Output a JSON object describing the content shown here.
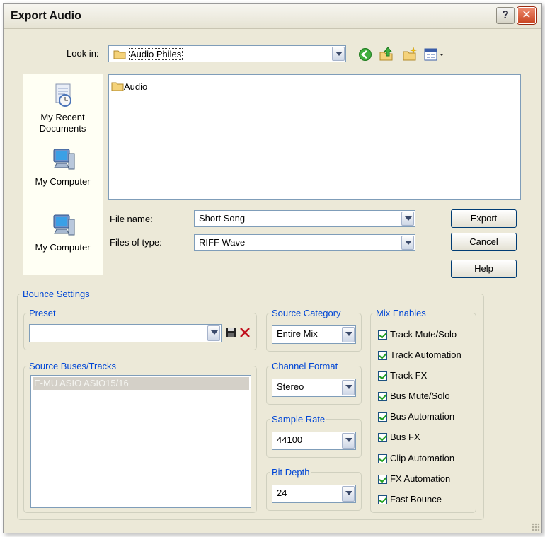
{
  "window": {
    "title": "Export Audio",
    "help_glyph": "?",
    "close_glyph": "✕"
  },
  "lookin": {
    "label": "Look in:",
    "value": "Audio Philes"
  },
  "places": [
    {
      "label_line1": "My Recent",
      "label_line2": "Documents"
    },
    {
      "label_line1": "My Computer",
      "label_line2": ""
    },
    {
      "label_line1": "My Computer",
      "label_line2": ""
    }
  ],
  "files": [
    {
      "name": "Audio",
      "kind": "folder"
    }
  ],
  "filename": {
    "label": "File name:",
    "value": "Short Song"
  },
  "filetype": {
    "label": "Files of type:",
    "value": "RIFF Wave"
  },
  "buttons": {
    "export": "Export",
    "cancel": "Cancel",
    "help": "Help"
  },
  "bounce": {
    "title": "Bounce Settings",
    "preset": {
      "title": "Preset",
      "value": ""
    },
    "source": {
      "title": "Source Buses/Tracks",
      "items": [
        "E-MU ASIO ASIO15/16"
      ]
    },
    "category": {
      "title": "Source Category",
      "value": "Entire Mix"
    },
    "channel": {
      "title": "Channel Format",
      "value": "Stereo"
    },
    "rate": {
      "title": "Sample Rate",
      "value": "44100"
    },
    "depth": {
      "title": "Bit Depth",
      "value": "24"
    },
    "mix": {
      "title": "Mix Enables",
      "items": [
        {
          "label": "Track Mute/Solo",
          "checked": true
        },
        {
          "label": "Track Automation",
          "checked": true
        },
        {
          "label": "Track FX",
          "checked": true
        },
        {
          "label": "Bus Mute/Solo",
          "checked": true
        },
        {
          "label": "Bus Automation",
          "checked": true
        },
        {
          "label": "Bus FX",
          "checked": true
        },
        {
          "label": "Clip Automation",
          "checked": true
        },
        {
          "label": "FX Automation",
          "checked": true
        },
        {
          "label": "Fast Bounce",
          "checked": true
        }
      ]
    }
  }
}
